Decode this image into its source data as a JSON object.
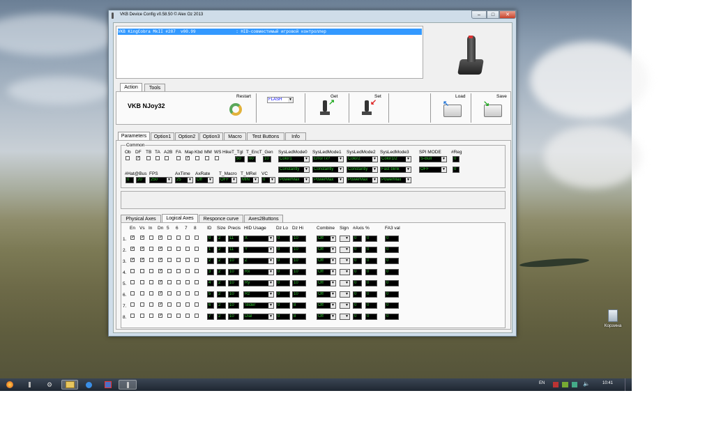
{
  "window": {
    "title": "VKB Device Config v0.58.50 © Alex Oz 2013",
    "minimize": "–",
    "maximize": "□",
    "close": "✕"
  },
  "device_list": {
    "selected": "VKB KingCobra MkII #287  v00.99                : HID-совместимый игровой контроллер"
  },
  "top_tabs": [
    "Action",
    "Tools"
  ],
  "action_panel": {
    "device_name": "VKB NJoy32",
    "restart": "Restart",
    "flash_select": "FLASH",
    "get": "Get",
    "set": "Set",
    "load": "Load",
    "save": "Save"
  },
  "param_tabs": [
    "Parameters",
    "Option1",
    "Option2",
    "Option3",
    "Macro",
    "Test Buttons",
    "Info"
  ],
  "common": {
    "group_label": "Common",
    "flag_labels": [
      "Ob",
      "DF",
      "TB",
      "TA",
      "A2B",
      "FA",
      "Map",
      "Kbd",
      "MM",
      "WS"
    ],
    "flag_checked": [
      false,
      true,
      false,
      false,
      false,
      false,
      true,
      false,
      false,
      false
    ],
    "hike_label": "HikeT_Tgl",
    "hike_value": "50",
    "enc_label": "T_EncT_Gen",
    "enc_values": [
      "00",
      "10"
    ],
    "led_labels": [
      "SysLedMode0",
      "SysLedMode1",
      "SysLedMode2",
      "SysLedMode3"
    ],
    "led_row1": [
      "Color1",
      "ErrorTx?",
      "Color2",
      "Color1/2"
    ],
    "led_row2": [
      "Constantly",
      "Constantly",
      "Constantly",
      "Fast blink"
    ],
    "led_row3": [
      "PowerMax",
      "PowerMax",
      "PowerMax",
      "PowerMax"
    ],
    "spi_label": "SPI MODE",
    "spi_values": [
      "S-Bull",
      "OFF"
    ],
    "reg_label": "#Reg",
    "reg_values": [
      "0",
      "0"
    ],
    "hat_label": "#Hat@Bus",
    "hat_values": [
      "0",
      "20"
    ],
    "fps_label": "FPS",
    "fps_value": "250",
    "axtime_label": "AxTime",
    "axtime_value": "25",
    "axrate_label": "AxRate",
    "axrate_value": "Off",
    "tmacro_label": "T_Macro",
    "tmacro_value": "OFF",
    "tmrel_label": "T_MRel",
    "tmrel_value": "MIN",
    "vc_label": "VC",
    "vc_value": "0"
  },
  "axes_tabs": [
    "Physical Axes",
    "Logical Axes",
    "Responce curve",
    "Axes2Buttons"
  ],
  "axes": {
    "headers": [
      "En",
      "Vs",
      "In",
      "Dn",
      "5",
      "6",
      "7",
      "8",
      "ID",
      "Size",
      "Precis",
      "HID Usage",
      "Dz Lo",
      "Dz Hi",
      "Combine",
      "Sign",
      "#Axis",
      "%",
      "FA3 val"
    ],
    "rows": [
      {
        "n": "1.",
        "cb": [
          true,
          true,
          false,
          true,
          false,
          false,
          false,
          false
        ],
        "id": "0",
        "size": "2",
        "precis": "11",
        "usage": "X",
        "dzlo": "0",
        "dzhi": "10",
        "combine": "Off",
        "sign": "",
        "axis": "0",
        "pct": "0",
        "fa3": "0"
      },
      {
        "n": "2.",
        "cb": [
          true,
          true,
          false,
          true,
          false,
          false,
          false,
          false
        ],
        "id": "1",
        "size": "2",
        "precis": "11",
        "usage": "Y",
        "dzlo": "0",
        "dzhi": "10",
        "combine": "Off",
        "sign": "",
        "axis": "0",
        "pct": "0",
        "fa3": "0"
      },
      {
        "n": "3.",
        "cb": [
          true,
          true,
          false,
          true,
          false,
          false,
          false,
          false
        ],
        "id": "2",
        "size": "2",
        "precis": "10",
        "usage": "Z",
        "dzlo": "0",
        "dzhi": "10",
        "combine": "Off",
        "sign": "",
        "axis": "0",
        "pct": "0",
        "fa3": "0"
      },
      {
        "n": "4.",
        "cb": [
          false,
          false,
          false,
          true,
          false,
          false,
          false,
          false
        ],
        "id": "3",
        "size": "2",
        "precis": "10",
        "usage": "Rx",
        "dzlo": "0",
        "dzhi": "10",
        "combine": "Off",
        "sign": "",
        "axis": "0",
        "pct": "0",
        "fa3": "0"
      },
      {
        "n": "5.",
        "cb": [
          false,
          false,
          false,
          true,
          false,
          false,
          false,
          false
        ],
        "id": "4",
        "size": "2",
        "precis": "10",
        "usage": "Ry",
        "dzlo": "0",
        "dzhi": "10",
        "combine": "Off",
        "sign": "",
        "axis": "0",
        "pct": "0",
        "fa3": "0"
      },
      {
        "n": "6.",
        "cb": [
          false,
          false,
          false,
          true,
          false,
          false,
          false,
          false
        ],
        "id": "5",
        "size": "2",
        "precis": "10",
        "usage": "Rz",
        "dzlo": "0",
        "dzhi": "10",
        "combine": "Off",
        "sign": "",
        "axis": "0",
        "pct": "0",
        "fa3": "0"
      },
      {
        "n": "7.",
        "cb": [
          false,
          false,
          false,
          true,
          false,
          false,
          false,
          false
        ],
        "id": "6",
        "size": "2",
        "precis": "10",
        "usage": "Slider",
        "dzlo": "0",
        "dzhi": "8",
        "combine": "Off",
        "sign": "",
        "axis": "0",
        "pct": "0",
        "fa3": "0"
      },
      {
        "n": "8.",
        "cb": [
          false,
          false,
          false,
          true,
          false,
          false,
          false,
          false
        ],
        "id": "7",
        "size": "2",
        "precis": "10",
        "usage": "Dial",
        "dzlo": "0",
        "dzhi": "8",
        "combine": "Off",
        "sign": "",
        "axis": "0",
        "pct": "0",
        "fa3": "0"
      }
    ]
  },
  "desktop": {
    "recycle_bin_label": "Корзина"
  },
  "taskbar": {
    "language": "EN",
    "clock": "10:41"
  }
}
